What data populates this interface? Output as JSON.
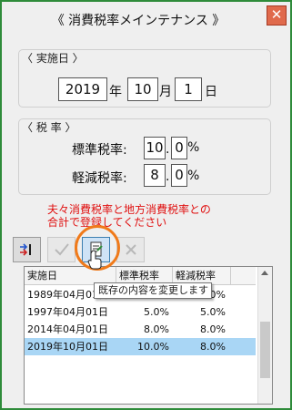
{
  "window": {
    "title": "《 消費税率メインテナンス 》",
    "close_symbol": "✕"
  },
  "date_group": {
    "label": "〈 実施日 〉",
    "year": "2019",
    "year_unit": "年",
    "month": "10",
    "month_unit": "月",
    "day": "1",
    "day_unit": "日"
  },
  "rate_group": {
    "label": "〈 税 率 〉",
    "standard": {
      "label": "標準税率:",
      "int": "10",
      "dec": "0",
      "unit": "%"
    },
    "reduced": {
      "label": "軽減税率:",
      "int": "8",
      "dec": "0",
      "unit": "%"
    },
    "dot": "."
  },
  "note": {
    "line1": "夫々消費税率と地方消費税率との",
    "line2": "合計で登録してください"
  },
  "list": {
    "headers": [
      "実施日",
      "標準税率",
      "軽減税率"
    ],
    "rows": [
      [
        "1989年04月01日",
        "3.0%",
        "0.0%"
      ],
      [
        "1997年04月01日",
        "5.0%",
        "5.0%"
      ],
      [
        "2014年04月01日",
        "8.0%",
        "8.0%"
      ],
      [
        "2019年10月01日",
        "10.0%",
        "8.0%"
      ]
    ],
    "selected_index": 3
  },
  "tooltip": "既存の内容を変更します",
  "icons": [
    "insert-icon",
    "check-icon",
    "edit-icon",
    "delete-icon",
    "hand-cursor-icon"
  ],
  "colors": {
    "frame": "#2e8b3a",
    "note": "#e01010",
    "selection": "#a9d6f5",
    "highlight": "#f07a1a"
  }
}
